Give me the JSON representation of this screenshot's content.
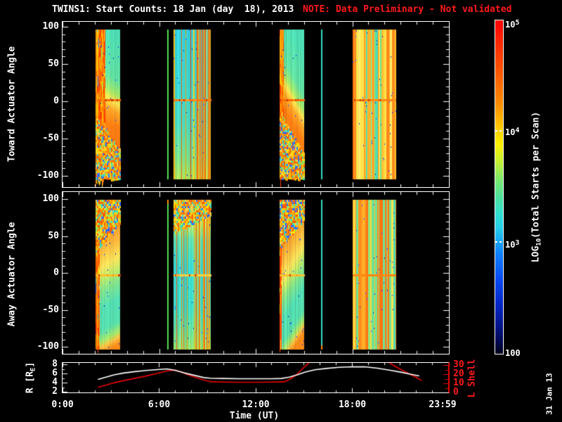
{
  "title": {
    "main": "TWINS1: Start Counts: 18 Jan (day  18), 2013",
    "note": "NOTE: Data Preliminary - Not validated"
  },
  "colors": {
    "bg": "#000000",
    "frame": "#ffffff",
    "red": "#ff1a1a",
    "r_line": "#ffffff",
    "l_line": "#e80000"
  },
  "left_axis": {
    "toward_label": "Toward Actuator Angle",
    "away_label": "Away Actuator Angle",
    "angle_tick_labels": [
      "100",
      "50",
      "0",
      "-50",
      "-100"
    ]
  },
  "orbit_axis": {
    "r_label_pre": "R [R",
    "r_label_sub": "E",
    "r_label_post": "]",
    "r_tick_labels": [
      "8",
      "6",
      "4",
      "2"
    ],
    "l_label": "L Shell",
    "l_tick_labels": [
      "30",
      "20",
      "10",
      "0"
    ]
  },
  "xaxis": {
    "label": "Time (UT)",
    "tick_labels": [
      "0:00",
      "6:00",
      "12:00",
      "18:00",
      "23:59"
    ],
    "tick_hours": [
      0,
      6,
      12,
      18,
      23.983
    ]
  },
  "colorbar": {
    "label_pre": "LOG",
    "label_sub": "10",
    "label_post": "(Total Starts per Scan)",
    "tick_labels": [
      {
        "b": "10",
        "e": "5"
      },
      {
        "b": "10",
        "e": "4"
      },
      {
        "b": "10",
        "e": "3"
      },
      {
        "b": "100",
        "e": ""
      }
    ]
  },
  "date_stamp": "31 Jan 13",
  "chart_data": {
    "type": "heatmap",
    "x_range_hours": [
      0,
      24
    ],
    "angle_range": [
      -100,
      100
    ],
    "colorbar_log_range": [
      2,
      5
    ],
    "palettes": {
      "warm": [
        "#ff3c00",
        "#ff5c00",
        "#ff7c00",
        "#ff9e00",
        "#ffc200",
        "#ffdc20"
      ],
      "noise": [
        "#ff8c00",
        "#ffb800",
        "#ffe400",
        "#ff5800",
        "#ff7000",
        "#3cd8c4",
        "#8ce860",
        "#ffd24a",
        "#2f6bff"
      ],
      "stripe_base": [
        "#ffe44c",
        "#ffd83e",
        "#ffc232",
        "#ff9c22",
        "#ff7410",
        "#ff8c1c",
        "#92e878",
        "#4cdcb4",
        "#6ee294",
        "#ffee6a",
        "#ffb42c"
      ],
      "pass_toward": [
        [
          0,
          "#4edcb4"
        ],
        [
          0.3,
          "#62dfa0"
        ],
        [
          0.4,
          "#a6e566"
        ],
        [
          0.46,
          "#ffdf4e"
        ],
        [
          0.52,
          "#ffa428"
        ],
        [
          0.62,
          "#ff7d12"
        ],
        [
          0.78,
          "#ff7a14"
        ],
        [
          1,
          "#ff9426"
        ]
      ],
      "cruise_toward": [
        [
          0,
          "#34d4e4"
        ],
        [
          0.35,
          "#3cdcd8"
        ],
        [
          0.62,
          "#4ce0c8"
        ],
        [
          0.85,
          "#7ce690"
        ],
        [
          1,
          "#b4ea5e"
        ]
      ],
      "pass_away": [
        [
          0,
          "#ff7d10"
        ],
        [
          0.15,
          "#ff8c1e"
        ],
        [
          0.3,
          "#ffb83c"
        ],
        [
          0.42,
          "#ffe45c"
        ],
        [
          0.5,
          "#c0ea6a"
        ],
        [
          0.58,
          "#84e48c"
        ],
        [
          0.7,
          "#54dfb4"
        ],
        [
          0.85,
          "#58dfae"
        ],
        [
          0.92,
          "#a8e86a"
        ],
        [
          0.96,
          "#ffc244"
        ],
        [
          1,
          "#ff8c1a"
        ]
      ],
      "cruise_away": [
        [
          0,
          "#ff9226"
        ],
        [
          0.08,
          "#ffc94a"
        ],
        [
          0.16,
          "#c6ec66"
        ],
        [
          0.26,
          "#62e2b2"
        ],
        [
          0.45,
          "#38dcd8"
        ],
        [
          0.72,
          "#40dfcc"
        ],
        [
          0.88,
          "#6ce49e"
        ],
        [
          1,
          "#9ce870"
        ]
      ]
    },
    "panels": [
      {
        "id": "toward",
        "bands": [
          {
            "t0": 2.04,
            "t1": 3.57,
            "kind": "field",
            "stops": "pass_toward",
            "streak": 0.38,
            "tilt": 0.1,
            "noise": {
              "side": "bottom",
              "from": 0.58,
              "slope": 0.22
            },
            "mid": 0.47,
            "midc": "#ff6a00",
            "speckle": true,
            "seed": 11
          },
          {
            "t0": 6.48,
            "t1": 6.56,
            "kind": "vline",
            "color": "#55e055"
          },
          {
            "t0": 6.91,
            "t1": 9.22,
            "kind": "field",
            "stops": "cruise_toward",
            "stripes": {
              "from": 0.52,
              "p1": 0.55,
              "p0": 0.1
            },
            "mid": 0.47,
            "midc": "#ff7a10",
            "speckle": true,
            "seed": 12
          },
          {
            "t0": 13.48,
            "t1": 15.02,
            "kind": "field",
            "stops": "pass_toward",
            "streak": 0.15,
            "tilt": 0.3,
            "noise": {
              "side": "bottom",
              "from": 0.55,
              "slope": 0.28
            },
            "mid": 0.47,
            "midc": "#ff6a00",
            "speckle": true,
            "seed": 13
          },
          {
            "t0": 16.04,
            "t1": 16.12,
            "kind": "vline",
            "color": "#35dec8"
          },
          {
            "t0": 18.04,
            "t1": 20.74,
            "kind": "stripes",
            "mid": 0.47,
            "midc": "#ff8510",
            "speckle": true,
            "seed": 14
          }
        ]
      },
      {
        "id": "away",
        "bands": [
          {
            "t0": 2.04,
            "t1": 3.57,
            "kind": "field",
            "stops": "pass_away",
            "streak": 0.15,
            "tilt": -0.1,
            "noise": {
              "side": "top",
              "from": 0.35,
              "slope": 0.2
            },
            "mid": 0.5,
            "midc": "#ffc22a",
            "speckle": true,
            "seed": 21
          },
          {
            "t0": 6.48,
            "t1": 6.56,
            "kind": "vline",
            "color": "#55e055",
            "cap": "top"
          },
          {
            "t0": 6.91,
            "t1": 9.22,
            "kind": "field",
            "stops": "cruise_away",
            "stripes": {
              "from": 0.55,
              "p1": 0.5,
              "p0": 0.1
            },
            "noise": {
              "side": "top",
              "from": 0.22,
              "slope": 0.12
            },
            "mid": 0.5,
            "midc": "#ffd040",
            "speckle": true,
            "seed": 22
          },
          {
            "t0": 13.48,
            "t1": 15.02,
            "kind": "field",
            "stops": "pass_away",
            "streak": 0.08,
            "tilt": -0.25,
            "noise": {
              "side": "top",
              "from": 0.33,
              "slope": 0.2
            },
            "mid": 0.5,
            "midc": "#ffc22a",
            "speckle": true,
            "seed": 23
          },
          {
            "t0": 16.04,
            "t1": 16.12,
            "kind": "vline",
            "color": "#35dec8",
            "cap": "bottom"
          },
          {
            "t0": 18.04,
            "t1": 20.74,
            "kind": "stripes",
            "mid": 0.5,
            "midc": "#ff8510",
            "speckle": true,
            "seed": 24
          }
        ]
      }
    ],
    "orbit": {
      "r_axis_ticks": [
        2,
        4,
        6,
        8
      ],
      "l_axis_ticks": [
        0,
        10,
        20,
        30
      ],
      "r_series": [
        [
          2.2,
          4.7
        ],
        [
          2.7,
          5.2
        ],
        [
          3.2,
          5.7
        ],
        [
          3.8,
          6.1
        ],
        [
          4.5,
          6.4
        ],
        [
          5.2,
          6.65
        ],
        [
          5.9,
          6.85
        ],
        [
          6.5,
          7.0
        ],
        [
          7.0,
          6.7
        ],
        [
          7.6,
          6.1
        ],
        [
          8.2,
          5.6
        ],
        [
          8.8,
          5.1
        ],
        [
          9.2,
          4.95
        ],
        [
          10,
          4.9
        ],
        [
          11,
          4.85
        ],
        [
          12,
          4.85
        ],
        [
          13,
          4.85
        ],
        [
          13.6,
          4.9
        ],
        [
          14.1,
          5.2
        ],
        [
          14.6,
          5.7
        ],
        [
          15.1,
          6.3
        ],
        [
          15.7,
          6.8
        ],
        [
          16.4,
          7.1
        ],
        [
          17.2,
          7.35
        ],
        [
          18.0,
          7.45
        ],
        [
          18.8,
          7.45
        ],
        [
          19.6,
          7.15
        ],
        [
          20.4,
          6.7
        ],
        [
          21.1,
          6.25
        ],
        [
          21.7,
          5.8
        ],
        [
          22.2,
          5.45
        ]
      ],
      "l_series": [
        [
          [
            2.2,
            5.5
          ],
          [
            2.7,
            8
          ],
          [
            3.2,
            10.5
          ],
          [
            3.8,
            13
          ],
          [
            4.5,
            15.5
          ],
          [
            5.2,
            18
          ],
          [
            5.9,
            21
          ],
          [
            6.6,
            23.8
          ],
          [
            7.0,
            24.5
          ],
          [
            7.5,
            21.5
          ],
          [
            8.1,
            17.5
          ],
          [
            8.7,
            14
          ],
          [
            9.2,
            11.8
          ],
          [
            10,
            11.4
          ],
          [
            11,
            11.2
          ],
          [
            12,
            11.2
          ],
          [
            13,
            11.3
          ],
          [
            13.8,
            11.6
          ],
          [
            14.2,
            15
          ],
          [
            14.6,
            20
          ],
          [
            15.0,
            27
          ],
          [
            15.5,
            35
          ]
        ],
        [
          [
            20.1,
            35
          ],
          [
            20.8,
            27.5
          ],
          [
            21.5,
            21
          ],
          [
            22.0,
            16.5
          ],
          [
            22.35,
            13
          ]
        ]
      ]
    }
  }
}
